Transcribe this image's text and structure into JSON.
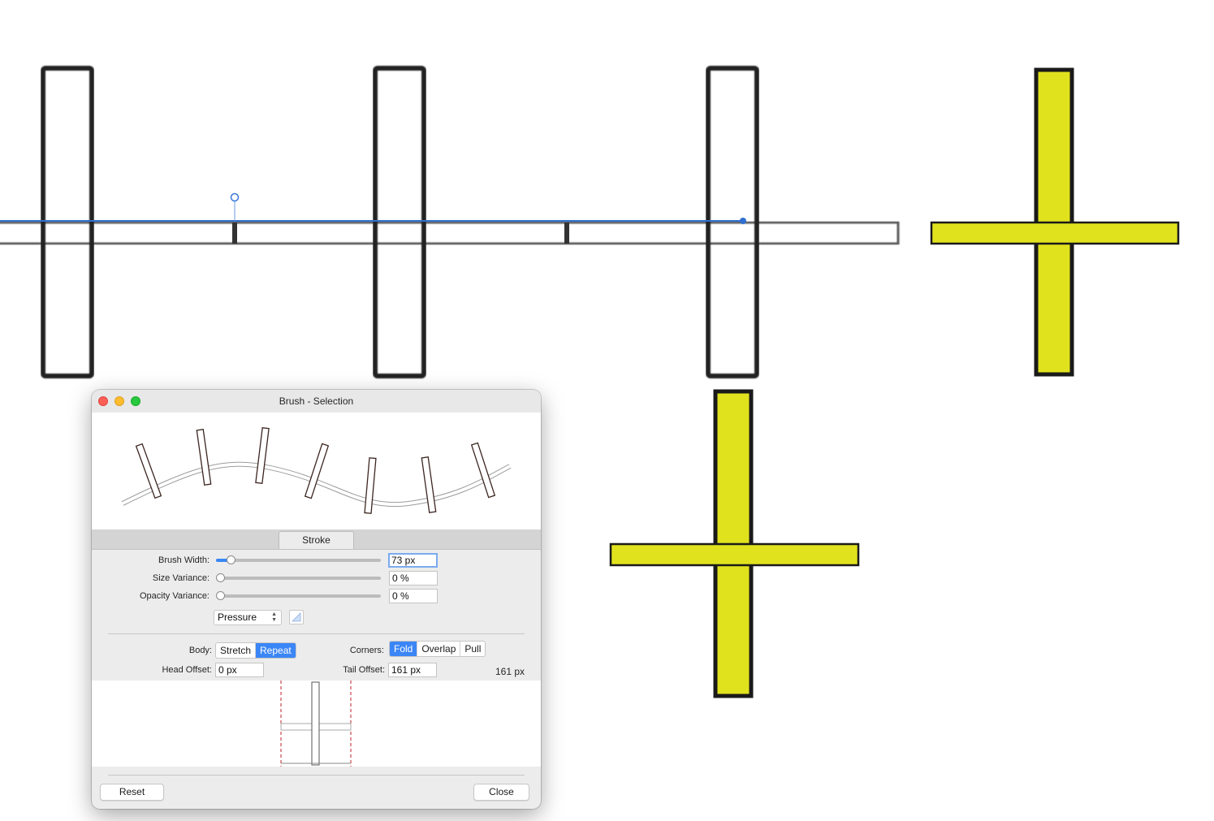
{
  "window": {
    "title": "Brush - Selection"
  },
  "tabs": {
    "active": "Stroke"
  },
  "stroke": {
    "brush_width_label": "Brush Width:",
    "brush_width_value": "73 px",
    "brush_width_level": 0.09,
    "size_variance_label": "Size Variance:",
    "size_variance_value": "0 %",
    "size_variance_level": 0,
    "opacity_variance_label": "Opacity Variance:",
    "opacity_variance_value": "0 %",
    "opacity_variance_level": 0,
    "controller": "Pressure"
  },
  "body": {
    "label": "Body:",
    "options": [
      "Stretch",
      "Repeat"
    ],
    "selected": "Repeat"
  },
  "corners": {
    "label": "Corners:",
    "options": [
      "Fold",
      "Overlap",
      "Pull"
    ],
    "selected": "Fold"
  },
  "head_offset": {
    "label": "Head Offset:",
    "value": "0 px"
  },
  "tail_offset": {
    "label": "Tail Offset:",
    "value": "161 px"
  },
  "texture_length": "161 px",
  "buttons": {
    "reset": "Reset",
    "close": "Close"
  },
  "colors": {
    "accent": "#3b86f6",
    "shape_fill": "#e1e21e",
    "shape_stroke": "#1a1a1a",
    "guide": "#2f6fd0"
  },
  "icons": [
    "close-light",
    "minimize-light",
    "zoom-light",
    "popup-arrows-icon",
    "pressure-curve-icon"
  ]
}
